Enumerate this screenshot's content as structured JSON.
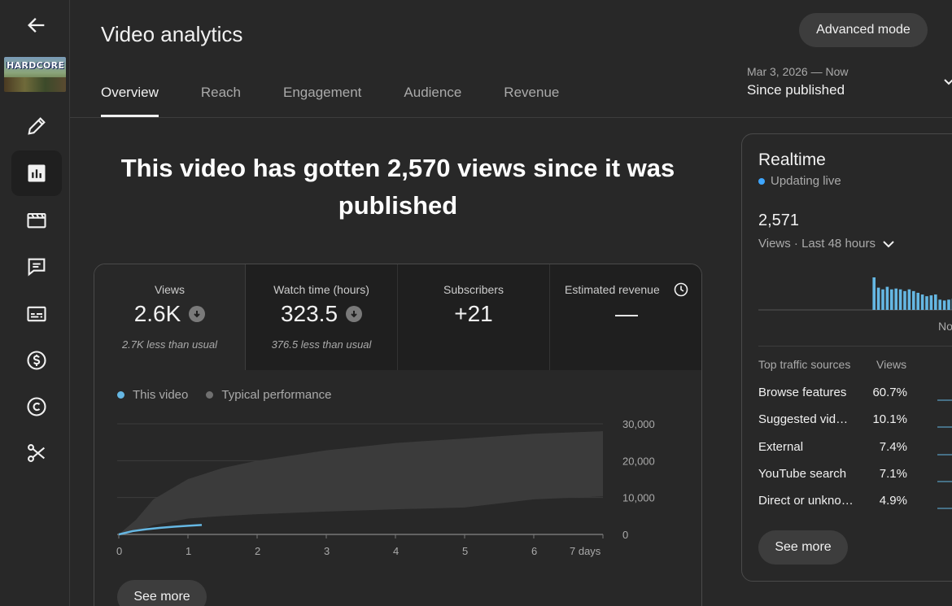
{
  "header": {
    "title": "Video analytics",
    "advanced_mode_label": "Advanced mode",
    "date_range": {
      "dates": "Mar 3, 2026 — Now",
      "label": "Since published"
    }
  },
  "video_thumbnail": {
    "text": "HARDCORE"
  },
  "nav_rail": {
    "items": [
      {
        "icon": "back-arrow-icon"
      },
      {
        "icon": "pencil-icon"
      },
      {
        "icon": "analytics-icon",
        "active": true
      },
      {
        "icon": "clapperboard-icon"
      },
      {
        "icon": "comments-icon"
      },
      {
        "icon": "subtitles-icon"
      },
      {
        "icon": "dollar-icon"
      },
      {
        "icon": "copyright-icon"
      },
      {
        "icon": "scissors-icon"
      }
    ]
  },
  "tabs": [
    {
      "label": "Overview",
      "active": true
    },
    {
      "label": "Reach"
    },
    {
      "label": "Engagement"
    },
    {
      "label": "Audience"
    },
    {
      "label": "Revenue"
    }
  ],
  "headline": "This video has gotten 2,570 views since it was published",
  "metrics": [
    {
      "label": "Views",
      "value": "2.6K",
      "note": "2.7K less than usual",
      "trend": "down"
    },
    {
      "label": "Watch time (hours)",
      "value": "323.5",
      "note": "376.5 less than usual",
      "trend": "down"
    },
    {
      "label": "Subscribers",
      "value": "+21",
      "note": ""
    },
    {
      "label": "Estimated revenue",
      "value": "—",
      "note": ""
    }
  ],
  "legend": {
    "this_video": "This video",
    "typical": "Typical performance"
  },
  "colors": {
    "accent": "#3ea6ff",
    "line": "#65b7e3",
    "band": "#3b3b3b"
  },
  "chart_data": {
    "type": "line",
    "x_ticks": [
      "0",
      "1",
      "2",
      "3",
      "4",
      "5",
      "6",
      "7 days"
    ],
    "y_ticks": [
      "0",
      "10,000",
      "20,000",
      "30,000"
    ],
    "xlim": [
      0,
      7
    ],
    "ylim": [
      0,
      30000
    ],
    "series": [
      {
        "name": "This video",
        "x": [
          0,
          0.2,
          0.4,
          0.6,
          0.8,
          1.0,
          1.15,
          1.2
        ],
        "y": [
          0,
          900,
          1400,
          1800,
          2100,
          2350,
          2500,
          2570
        ]
      },
      {
        "name": "Typical performance",
        "band": true,
        "x": [
          0,
          0.25,
          0.5,
          1,
          1.5,
          2,
          3,
          4,
          5,
          6,
          7
        ],
        "y_low": [
          0,
          800,
          2500,
          4300,
          5000,
          5500,
          6200,
          6800,
          7300,
          9500,
          10300
        ],
        "y_high": [
          0,
          4000,
          9500,
          15000,
          18000,
          20000,
          22800,
          24800,
          26000,
          27300,
          28000
        ]
      }
    ],
    "grid": true,
    "legend_position": "top-left"
  },
  "see_more_label": "See more",
  "realtime": {
    "title": "Realtime",
    "status": "Updating live",
    "count": "2,571",
    "subtitle": "Views · Last 48 hours",
    "now_label": "Now",
    "bars": [
      0,
      0,
      0,
      0,
      0,
      0,
      0,
      0,
      0,
      0,
      0,
      0,
      0,
      0,
      0,
      0,
      0,
      0,
      0,
      0,
      0,
      0,
      0,
      0,
      0,
      0,
      38,
      26,
      24,
      27,
      24,
      25,
      24,
      22,
      24,
      22,
      20,
      18,
      16,
      17,
      18,
      12,
      11,
      12,
      13,
      9,
      12,
      11,
      10,
      9
    ],
    "traffic_header": {
      "source": "Top traffic sources",
      "views": "Views"
    },
    "traffic_sources": [
      {
        "name": "Browse features",
        "percent": "60.7%"
      },
      {
        "name": "Suggested vid…",
        "percent": "10.1%"
      },
      {
        "name": "External",
        "percent": "7.4%"
      },
      {
        "name": "YouTube search",
        "percent": "7.1%"
      },
      {
        "name": "Direct or unkno…",
        "percent": "4.9%"
      }
    ]
  }
}
